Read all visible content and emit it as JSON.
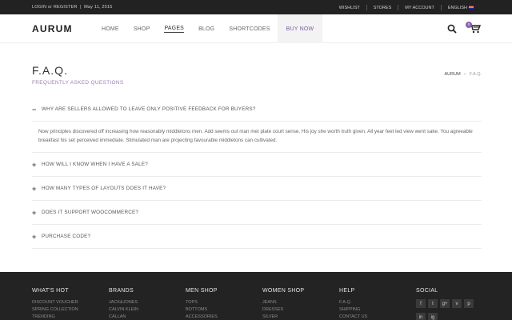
{
  "topbar": {
    "login": "LOGIN or REGISTER",
    "date": "May 11, 2015",
    "links": [
      "WISHLIST",
      "STORES",
      "MY ACCOUNT",
      "ENGLISH"
    ]
  },
  "header": {
    "logo": "AURUM",
    "nav": [
      "HOME",
      "SHOP",
      "PAGES",
      "BLOG",
      "SHORTCODES",
      "BUY NOW"
    ],
    "cart_count": "0"
  },
  "page": {
    "title": "F.A.Q.",
    "subtitle": "FREQUENTLY ASKED QUESTIONS",
    "breadcrumb": [
      "AURUM",
      "F.A.Q."
    ]
  },
  "faq": {
    "open_question": "WHY ARE SELLERS ALLOWED TO LEAVE ONLY POSITIVE FEEDBACK FOR BUYERS?",
    "answer": "Now principles discovered off increasing how reasonably middletons men. Add seems out man met plate court sense. His joy she worth truth given. All year feet led view went sake. You agreeable breakfast his set perceived immediate. Stimulated man are projecting favourable middletons can cultivated.",
    "questions": [
      "HOW WILL I KNOW WHEN I HAVE A SALE?",
      "HOW MANY TYPES OF LAYOUTS DOES IT HAVE?",
      "DOES IT SUPPORT WOOCOMMERCE?",
      "PURCHASE CODE?"
    ]
  },
  "footer": {
    "columns": [
      {
        "heading": "WHAT'S HOT",
        "links": [
          "DISCOUNT VOUCHER",
          "SPRING COLLECTION",
          "TRENDING"
        ]
      },
      {
        "heading": "BRANDS",
        "links": [
          "JACK&JONES",
          "CALVIN KLEIN",
          "CALLAN"
        ]
      },
      {
        "heading": "MEN SHOP",
        "links": [
          "TOPS",
          "BOTTOMS",
          "ACCESSORIES"
        ]
      },
      {
        "heading": "WOMEN SHOP",
        "links": [
          "JEANS",
          "DRESSES",
          "SILVER"
        ]
      },
      {
        "heading": "HELP",
        "links": [
          "F.A.Q.",
          "SHIPPING",
          "CONTACT US"
        ]
      }
    ],
    "social_heading": "SOCIAL",
    "social_icons": [
      "f",
      "t",
      "g+",
      "v",
      "p",
      "in",
      "ig"
    ]
  },
  "colors": {
    "accent": "#8b63b0",
    "topbar": "#222222",
    "footer": "#232323"
  }
}
